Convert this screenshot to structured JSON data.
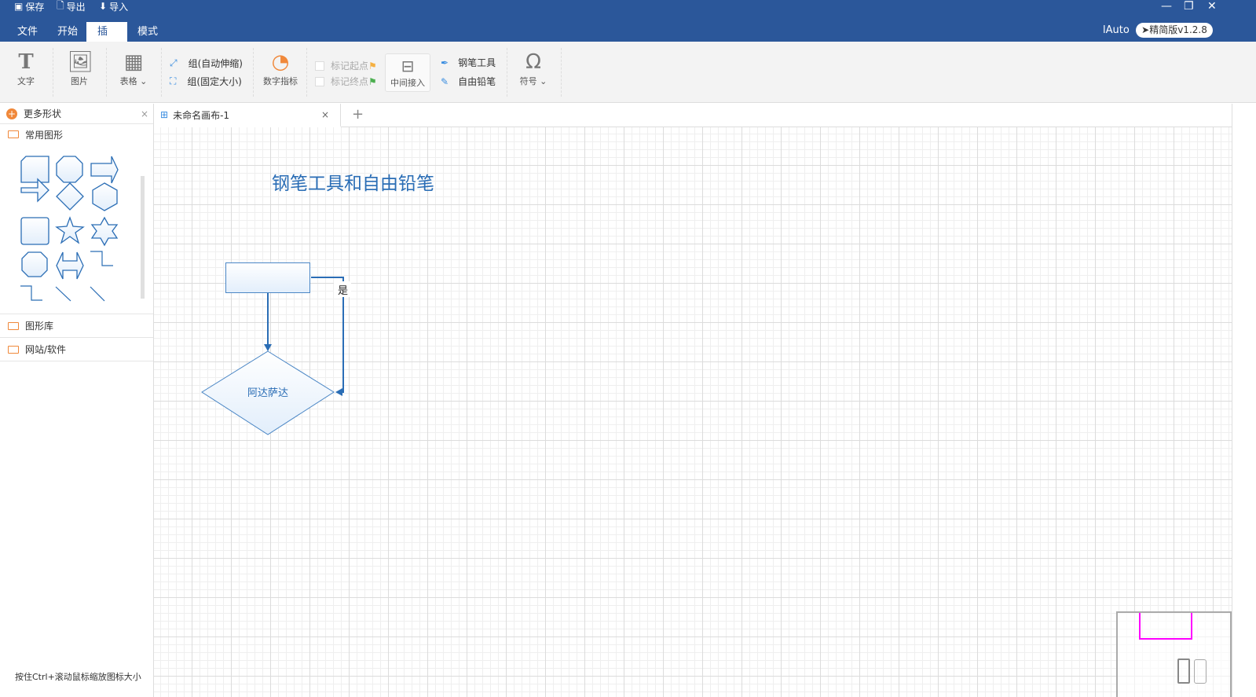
{
  "quick_access": [
    {
      "icon": "save-icon",
      "label": "保存"
    },
    {
      "icon": "export-icon",
      "label": "导出"
    },
    {
      "icon": "import-icon",
      "label": "导入"
    }
  ],
  "menu": [
    {
      "label": "文件"
    },
    {
      "label": "开始"
    },
    {
      "label": "插入",
      "active": true
    },
    {
      "label": "模式"
    }
  ],
  "user": "lAuto",
  "version": "精简版v1.2.8",
  "ribbon": {
    "text": "文字",
    "image": "图片",
    "table": "表格",
    "group_auto": "组(自动伸缩)",
    "group_fixed": "组(固定大小)",
    "metric": "数字指标",
    "mark_start": "标记起点",
    "mark_end": "标记终点",
    "middle_insert": "中间接入",
    "pen_tool": "钢笔工具",
    "free_pencil": "自由铅笔",
    "symbol": "符号"
  },
  "sidebar": {
    "title": "更多形状",
    "common": "常用图形",
    "library": "图形库",
    "web": "网站/软件",
    "hint": "按住Ctrl+滚动鼠标缩放图标大小"
  },
  "tab": {
    "label": "未命名画布-1"
  },
  "canvas": {
    "title": "钢笔工具和自由铅笔",
    "diamond_text": "阿达萨达",
    "edge_label": "是"
  },
  "colors": {
    "brand": "#2b579a",
    "shape_stroke": "#2a6db5",
    "minimap_frame": "#ff00ff"
  }
}
